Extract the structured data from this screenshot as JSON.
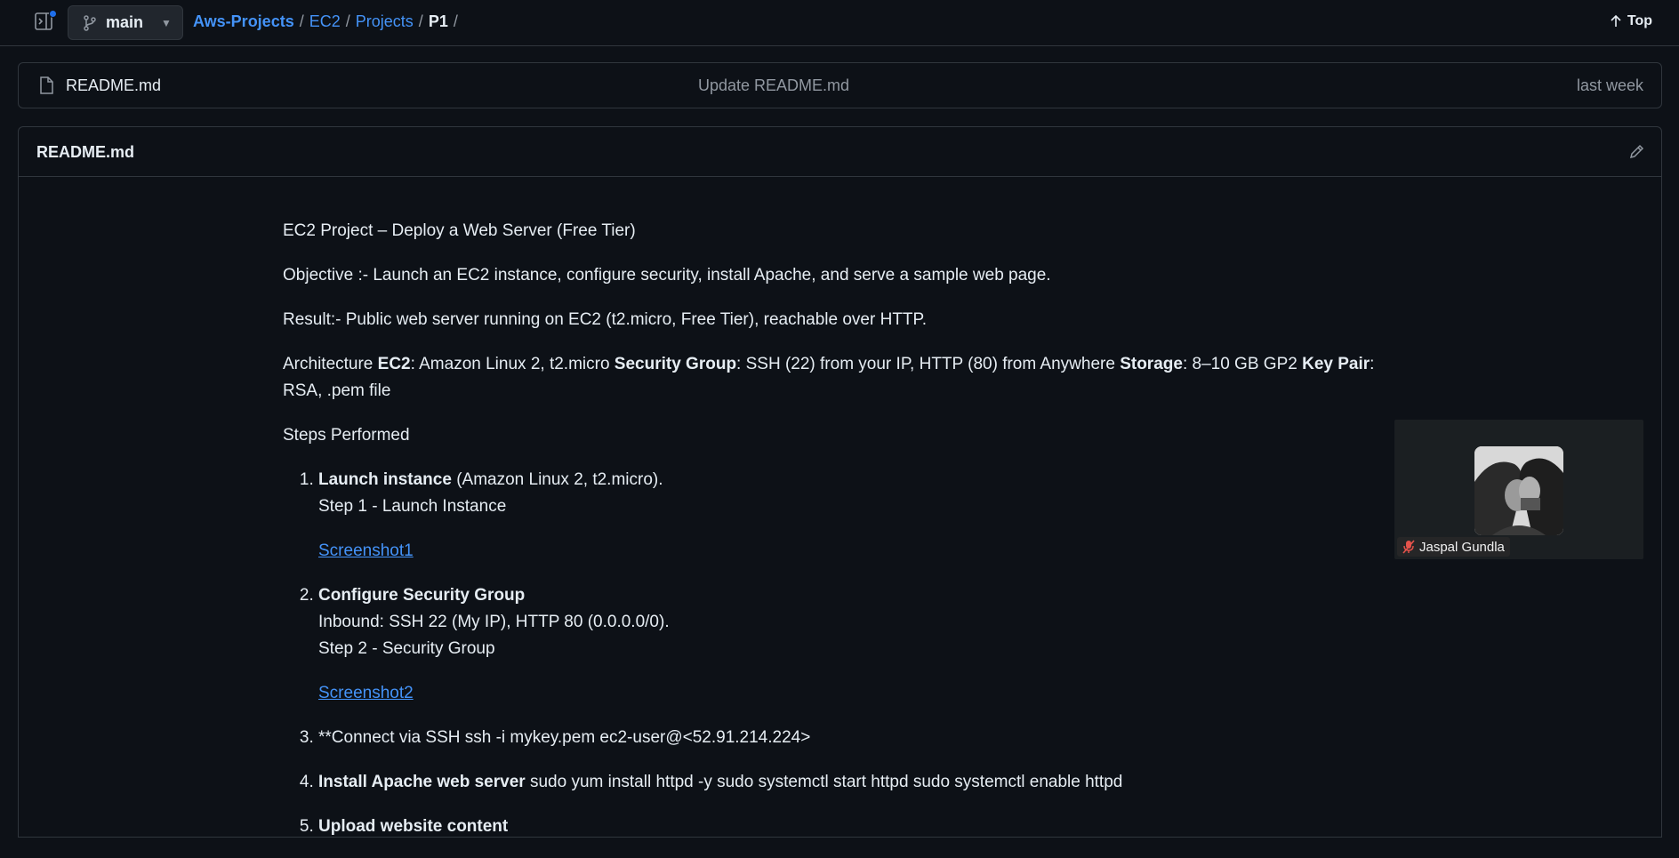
{
  "header": {
    "branch": "main",
    "breadcrumb": {
      "repo": "Aws-Projects",
      "path1": "EC2",
      "path2": "Projects",
      "current": "P1",
      "sep": "/"
    },
    "top_label": "Top"
  },
  "files": [
    {
      "name": "README.md",
      "commit": "Update README.md",
      "time": "last week"
    }
  ],
  "readme": {
    "title": "README.md",
    "heading": "EC2 Project – Deploy a Web Server (Free Tier)",
    "objective": "Objective :- Launch an EC2 instance, configure security, install Apache, and serve a sample web page.",
    "result": "Result:- Public web server running on EC2 (t2.micro, Free Tier), reachable over HTTP.",
    "arch": {
      "prefix": "Architecture ",
      "ec2_label": "EC2",
      "ec2_text": ": Amazon Linux 2, t2.micro ",
      "sg_label": "Security Group",
      "sg_text": ": SSH (22) from your IP, HTTP (80) from Anywhere ",
      "storage_label": "Storage",
      "storage_text": ": 8–10 GB GP2 ",
      "kp_label": "Key Pair",
      "kp_text": ": RSA, .pem file"
    },
    "steps_title": "Steps Performed",
    "steps": [
      {
        "bold": "Launch instance",
        "text": " (Amazon Linux 2, t2.micro).",
        "line2": "Step 1 - Launch Instance",
        "link": "Screenshot1"
      },
      {
        "bold": "Configure Security Group",
        "line2": "Inbound: SSH 22 (My IP), HTTP 80 (0.0.0.0/0).",
        "line3": "Step 2 - Security Group",
        "link": "Screenshot2"
      },
      {
        "text": "**Connect via SSH ssh -i mykey.pem ec2-user@<52.91.214.224>"
      },
      {
        "bold": "Install Apache web server",
        "text": " sudo yum install httpd -y sudo systemctl start httpd sudo systemctl enable httpd"
      },
      {
        "bold": "Upload website content"
      }
    ]
  },
  "video_call": {
    "participant": "Jaspal Gundla"
  },
  "colors": {
    "background": "#0d1117",
    "border": "#30363d",
    "link": "#4493f8",
    "muted": "#9198a1",
    "text": "#e6edf3"
  }
}
